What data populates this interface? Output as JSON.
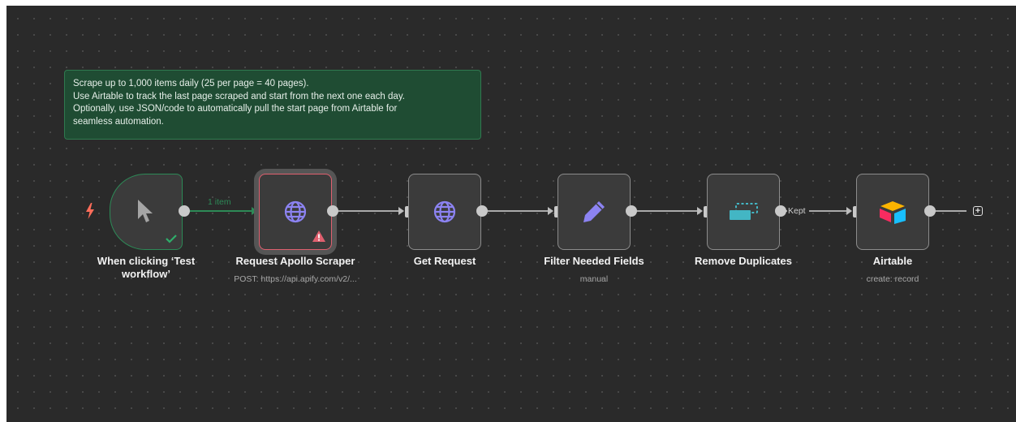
{
  "sticky_note": {
    "lines": [
      "Scrape up to 1,000 items daily (25 per page = 40 pages).",
      "Use Airtable to track the last page scraped and start from the next one each day.",
      "Optionally, use JSON/code to automatically pull the start page from Airtable for",
      "seamless automation."
    ]
  },
  "nodes": [
    {
      "name": "When clicking ‘Test workflow’",
      "name_line1": "When clicking ‘Test",
      "name_line2": "workflow’",
      "subtitle": "",
      "icon": "cursor-icon",
      "status": "success"
    },
    {
      "name": "Request Apollo Scraper",
      "subtitle": "POST: https://api.apify.com/v2/...",
      "icon": "globe-icon",
      "status": "error"
    },
    {
      "name": "Get Request",
      "subtitle": "",
      "icon": "globe-icon",
      "status": ""
    },
    {
      "name": "Filter Needed Fields",
      "subtitle": "manual",
      "icon": "pencil-icon",
      "status": ""
    },
    {
      "name": "Remove Duplicates",
      "subtitle": "",
      "icon": "remove-duplicates-icon",
      "status": ""
    },
    {
      "name": "Airtable",
      "subtitle": "create: record",
      "icon": "airtable-icon",
      "status": ""
    }
  ],
  "edges": [
    {
      "from": "When clicking ‘Test workflow’",
      "to": "Request Apollo Scraper",
      "label": "1 item"
    },
    {
      "from": "Request Apollo Scraper",
      "to": "Get Request",
      "label": ""
    },
    {
      "from": "Get Request",
      "to": "Filter Needed Fields",
      "label": ""
    },
    {
      "from": "Filter Needed Fields",
      "to": "Remove Duplicates",
      "label": ""
    },
    {
      "from": "Remove Duplicates",
      "to": "Airtable",
      "label": "Kept"
    }
  ],
  "add_node_button": {
    "label": "+"
  },
  "colors": {
    "canvas": "#2a2a2a",
    "node": "#3b3b3b",
    "success": "#2d8a57",
    "error": "#e0606f",
    "trigger_bolt": "#ff6d5a",
    "globe": "#8c83f2",
    "remove_duplicates": "#43b6c4"
  }
}
